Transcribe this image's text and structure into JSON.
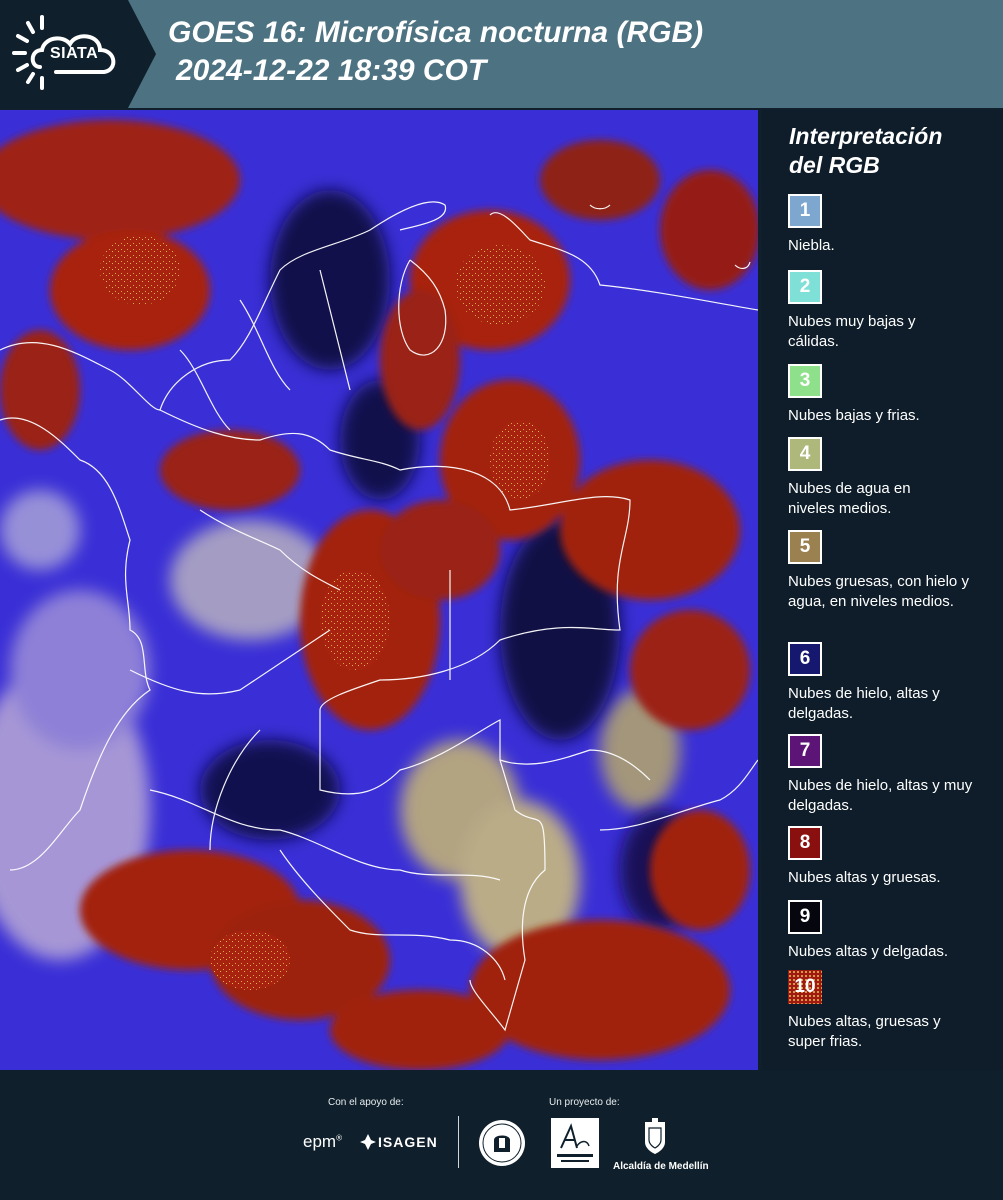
{
  "header": {
    "logo_text": "SIATA",
    "title_line1": "GOES 16: Microfísica nocturna (RGB)",
    "title_line2": "2024-12-22 18:39 COT"
  },
  "map": {
    "description_colors": {
      "background": "#3a2fd6",
      "thick_high_clouds": "#a5240f",
      "thin_high_clouds": "#0a0a2a",
      "mid_level": "#c9b978",
      "borders": "#ffffff"
    }
  },
  "legend": {
    "title_line1": "Interpretación",
    "title_line2": "del RGB",
    "items": [
      {
        "number": "1",
        "color": "#7da7cf",
        "label": "Niebla."
      },
      {
        "number": "2",
        "color": "#7fe0d8",
        "label": "Nubes muy bajas y cálidas."
      },
      {
        "number": "3",
        "color": "#8fe08b",
        "label": "Nubes bajas y frias."
      },
      {
        "number": "4",
        "color": "#adb87a",
        "label": "Nubes de agua en niveles medios."
      },
      {
        "number": "5",
        "color": "#9c8150",
        "label": "Nubes gruesas, con hielo y agua, en niveles medios."
      },
      {
        "number": "6",
        "color": "#15186e",
        "label": "Nubes de hielo, altas y delgadas."
      },
      {
        "number": "7",
        "color": "#5c1576",
        "label": "Nubes de hielo, altas y muy delgadas."
      },
      {
        "number": "8",
        "color": "#8a1010",
        "label": "Nubes altas y gruesas."
      },
      {
        "number": "9",
        "color": "#06060f",
        "label": "Nubes altas y delgadas."
      },
      {
        "number": "10",
        "color": "#a01a12",
        "label": "Nubes altas, gruesas y super frias."
      }
    ]
  },
  "footer": {
    "support_label": "Con el apoyo de:",
    "project_label": "Un proyecto de:",
    "epm": "epm",
    "isagen": "ISAGEN",
    "alcaldia": "Alcaldía de Medellín"
  }
}
